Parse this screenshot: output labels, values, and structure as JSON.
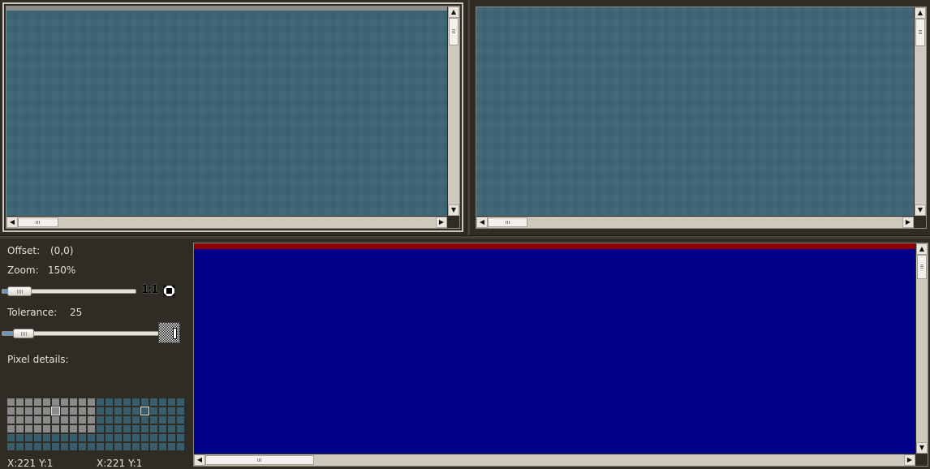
{
  "colors": {
    "background": "#2e2c25",
    "image_fill": "#3d6574",
    "diff_fill": "#010088",
    "diff_edge": "#8b0000",
    "scrollbar": "#cfc8bd",
    "pixel_gray": "#8a8a8a",
    "pixel_teal": "#365e6c"
  },
  "controls": {
    "offset_label": "Offset:",
    "offset_value": "(0,0)",
    "zoom_label": "Zoom:",
    "zoom_value": "150%",
    "zoom_one_to_one": "1:1",
    "tolerance_label": "Tolerance:",
    "tolerance_value": "25",
    "pixel_details_label": "Pixel details:"
  },
  "pixel_details": {
    "left_coords": "X:221 Y:1",
    "right_coords": "X:221 Y:1"
  },
  "icons": {
    "fit": "fit-to-window-icon",
    "scroll_up": "arrow-up-icon",
    "scroll_down": "arrow-down-icon",
    "scroll_left": "arrow-left-icon",
    "scroll_right": "arrow-right-icon"
  }
}
